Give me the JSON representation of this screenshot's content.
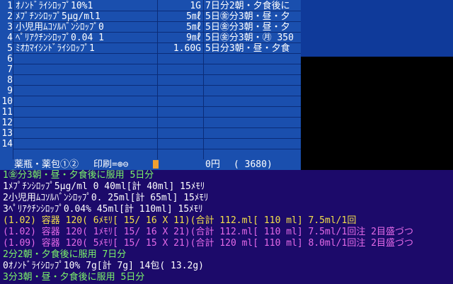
{
  "rows": [
    {
      "num": "1",
      "drug": "ｵﾉﾝﾄﾞﾗｲｼﾛｯﾌﾟ10%1",
      "qty": "1G",
      "usage": "7日分2朝・夕食後に"
    },
    {
      "num": "2",
      "drug": "ﾒﾌﾟﾁﾝｼﾛｯﾌﾟ5μg/ml1",
      "qty": "5㎖",
      "usage": "5日㊎分3朝・昼・夕"
    },
    {
      "num": "3",
      "drug": "小児用ﾑｺｿﾙﾊﾞﾝｼﾛｯﾌﾟ0",
      "qty": "5㎖",
      "usage": "5日㊎分3朝・昼・夕"
    },
    {
      "num": "4",
      "drug": "ﾍﾟﾘｱｸﾁﾝｼﾛｯﾌﾟ0.04 1",
      "qty": "9㎖",
      "usage": "5日㊎分3朝・㊊ 350"
    },
    {
      "num": "5",
      "drug": "ﾐｵｶﾏｲｼﾝﾄﾞﾗｲｼﾛｯﾌﾟ1",
      "qty": "1.60G",
      "usage": "5日分3朝・昼・夕食"
    },
    {
      "num": "6",
      "drug": "",
      "qty": "",
      "usage": ""
    },
    {
      "num": "7",
      "drug": "",
      "qty": "",
      "usage": ""
    },
    {
      "num": "8",
      "drug": "",
      "qty": "",
      "usage": ""
    },
    {
      "num": "9",
      "drug": "",
      "qty": "",
      "usage": ""
    },
    {
      "num": "10",
      "drug": "",
      "qty": "",
      "usage": ""
    },
    {
      "num": "11",
      "drug": "",
      "qty": "",
      "usage": ""
    },
    {
      "num": "12",
      "drug": "",
      "qty": "",
      "usage": ""
    },
    {
      "num": "13",
      "drug": "",
      "qty": "",
      "usage": ""
    },
    {
      "num": "14",
      "drug": "",
      "qty": "",
      "usage": ""
    }
  ],
  "summary": {
    "left": "薬瓶・薬包①②",
    "print": "印刷=⊕⊖",
    "price": "0円",
    "total": "( 3680)"
  },
  "detail": [
    {
      "text": "1㊎分3朝・昼・夕食後に服用 5日分",
      "color": "green"
    },
    {
      "text": "1ﾒﾌﾟﾁﾝｼﾛｯﾌﾟ5μg/ml 0 40ml[計 40ml] 15ﾒﾓﾘ",
      "color": "white"
    },
    {
      "text": "2小児用ﾑｺｿﾙﾊﾞﾝｼﾛｯﾌﾟ0. 25ml[計 65ml] 15ﾒﾓﾘ",
      "color": "white"
    },
    {
      "text": "3ﾍﾟﾘｱｸﾁﾝｼﾛｯﾌﾟ0.04%    45ml[計 110ml] 15ﾒﾓﾘ",
      "color": "white"
    },
    {
      "text": "(1.02) 容器 120( 6ﾒﾓﾘ[ 15/ 16 X 11)(合計 112.ml[ 110 ml]   7.5ml/1回",
      "color": "yellow"
    },
    {
      "text": "(1.02) 容器 120( 1ﾒﾓﾘ[ 15/ 16 X 21)(合計 112.ml[ 110 ml]   7.5ml/1回注 2目盛づつ",
      "color": "magenta"
    },
    {
      "text": "(1.09) 容器 120( 5ﾒﾓﾘ[ 15/ 15 X 21)(合計 120 ml[ 110 ml]   8.0ml/1回注 2目盛づつ",
      "color": "magenta"
    },
    {
      "text": "2分2朝・夕食後に服用 7日分",
      "color": "green"
    },
    {
      "text": "0ｵﾉﾝﾄﾞﾗｲｼﾛｯﾌﾟ10%        7g[計 7g] 14包( 13.2g)",
      "color": "white"
    },
    {
      "text": "3分3朝・昼・夕食後に服用 5日分",
      "color": "green"
    }
  ]
}
